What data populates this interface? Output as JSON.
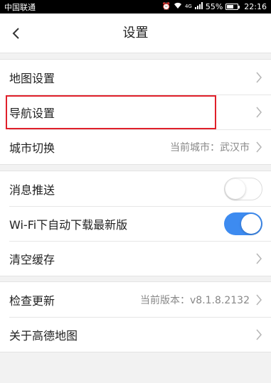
{
  "status_bar": {
    "carrier": "中国联通",
    "signal_label": "4G",
    "battery_percent": "55%",
    "battery_level": 0.55,
    "time": "22:16"
  },
  "header": {
    "title": "设置",
    "back_icon": "chevron-left-icon"
  },
  "groups": [
    {
      "items": [
        {
          "label": "地图设置"
        },
        {
          "label": "导航设置"
        },
        {
          "label": "城市切换",
          "value": "当前城市：武汉市"
        }
      ]
    },
    {
      "items": [
        {
          "label": "消息推送",
          "toggle": false
        },
        {
          "label": "Wi-Fi下自动下载最新版",
          "toggle": true
        },
        {
          "label": "清空缓存"
        }
      ]
    },
    {
      "items": [
        {
          "label": "检查更新",
          "value": "当前版本：v8.1.8.2132"
        },
        {
          "label": "关于高德地图"
        }
      ]
    }
  ],
  "colors": {
    "toggle_on": "#3d8bf0",
    "highlight_box": "#e0202a",
    "background": "#f2f2f2"
  }
}
